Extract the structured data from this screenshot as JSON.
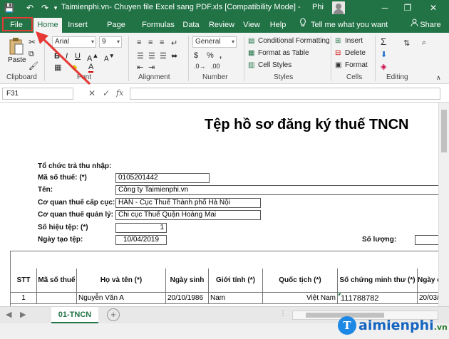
{
  "window": {
    "title": "Taimienphi.vn- Chuyen file Excel sang PDF.xls  [Compatibility Mode]  -",
    "user": "Phi",
    "controls": {
      "minimize": "─",
      "restore": "❐",
      "close": "✕"
    }
  },
  "quick_access": {
    "save": "💾",
    "undo": "↶",
    "redo": "↷",
    "customize": "▾"
  },
  "tabs": [
    "File",
    "Home",
    "Insert",
    "Page Layout",
    "Formulas",
    "Data",
    "Review",
    "View",
    "Help"
  ],
  "tell_me": "Tell me what you want to do",
  "share": "Share",
  "ribbon": {
    "clipboard": {
      "label": "Clipboard",
      "paste": "Paste"
    },
    "font": {
      "label": "Font",
      "family": "Arial",
      "size": "9"
    },
    "alignment": {
      "label": "Alignment"
    },
    "number": {
      "label": "Number",
      "format": "General"
    },
    "styles": {
      "label": "Styles",
      "conditional": "Conditional Formatting",
      "format_table": "Format as Table",
      "cell_styles": "Cell Styles"
    },
    "cells": {
      "label": "Cells",
      "insert": "Insert",
      "delete": "Delete",
      "format": "Format"
    },
    "editing": {
      "label": "Editing"
    }
  },
  "formula_bar": {
    "cell": "F31",
    "fx": "fx",
    "value": ""
  },
  "sheet": {
    "title": "Tệp hồ sơ đăng ký thuế TNCN",
    "org_label": "Tổ chức trả thu nhập:",
    "fields": [
      {
        "label": "Mã số thuế: (*)",
        "value": "0105201442"
      },
      {
        "label": "Tên:",
        "value": "Công ty Taimienphi.vn"
      },
      {
        "label": "Cơ quan thuế cấp cục:",
        "value": "HAN - Cục Thuế Thành phố Hà Nội"
      },
      {
        "label": "Cơ quan thuế quản lý: (*)",
        "value": "Chi cục Thuế Quận Hoàng Mai"
      },
      {
        "label": "Số hiệu tệp: (*)",
        "value": "1"
      },
      {
        "label": "Ngày tạo tệp:",
        "value": "10/04/2019"
      }
    ],
    "quantity_label": "Số lượng:",
    "table": {
      "headers": [
        "STT",
        "Mã số thuế",
        "Họ và tên (*)",
        "Ngày sinh",
        "Giới tính (*)",
        "Quốc tịch (*)",
        "Số chứng minh thư (*)",
        "Ngày c"
      ],
      "rows": [
        [
          "1",
          "",
          "Nguyễn Văn A",
          "20/10/1986",
          "Nam",
          "Việt Nam",
          "111788782",
          "20/03/2"
        ]
      ]
    }
  },
  "sheet_tabs": {
    "active": "01-TNCN",
    "add": "+"
  },
  "watermark": {
    "logo": "T",
    "text": "aimienphi",
    "suffix": ".vn"
  }
}
